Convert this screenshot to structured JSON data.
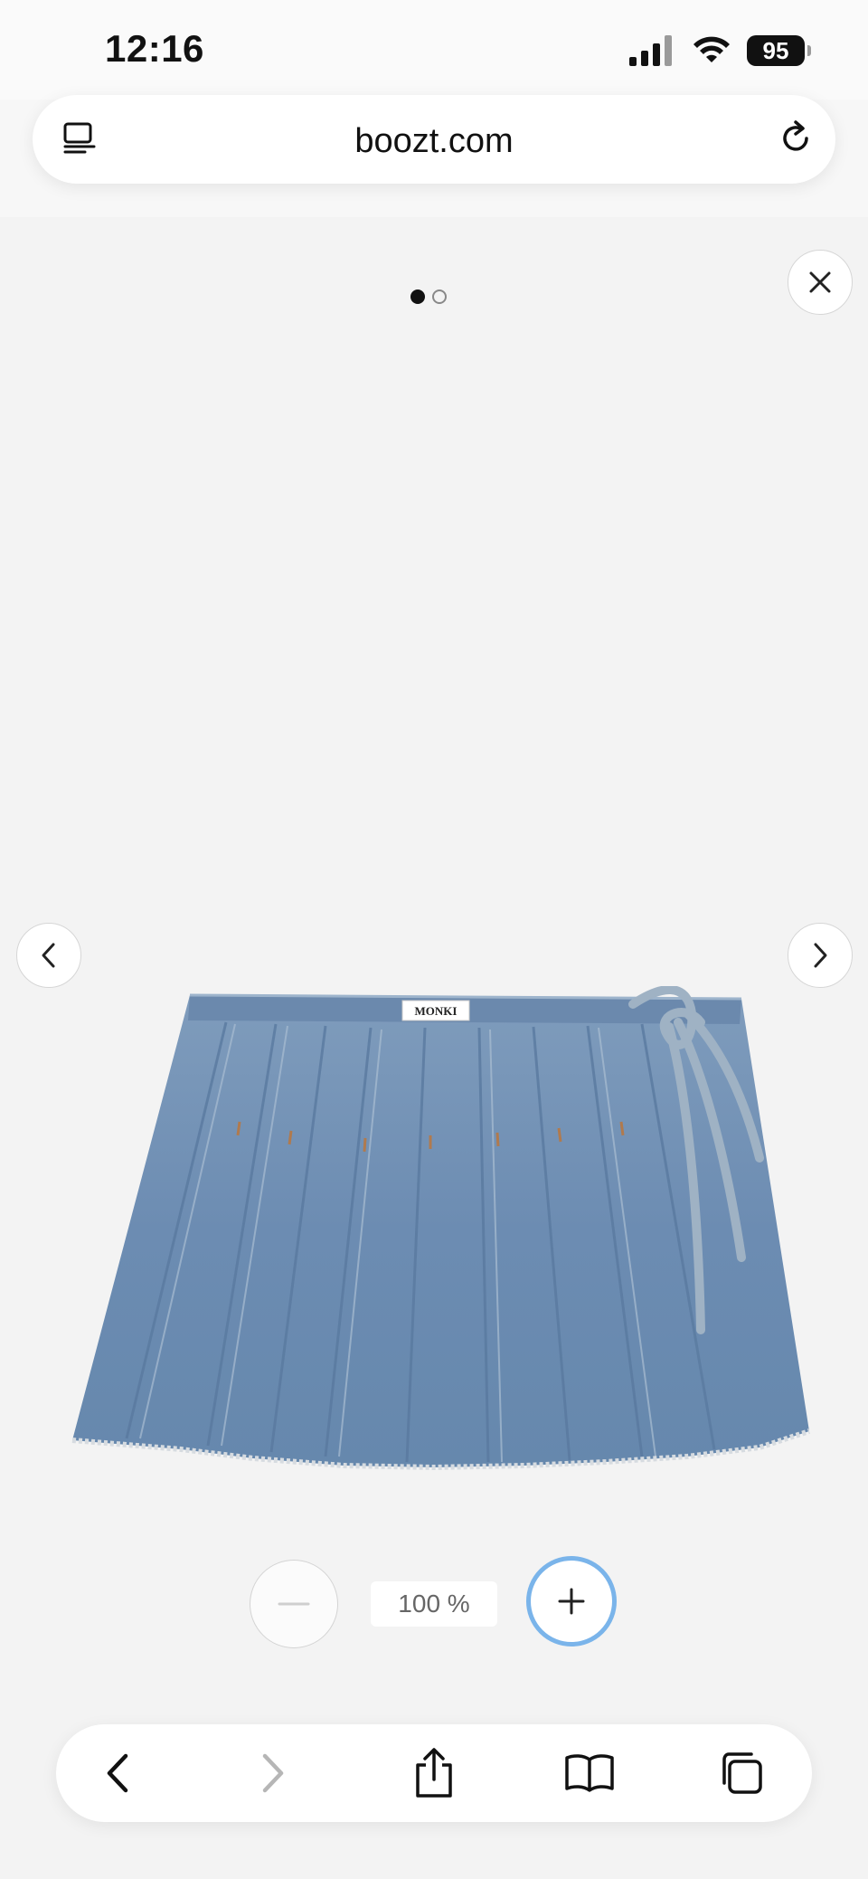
{
  "status_bar": {
    "time": "12:16",
    "battery": "95",
    "icons": [
      "signal-icon",
      "wifi-icon",
      "battery-icon"
    ]
  },
  "browser": {
    "url": "boozt.com",
    "left_icon": "page-menu-icon",
    "right_icon": "reload-icon"
  },
  "gallery": {
    "page_count": 2,
    "current_page": 1,
    "close_icon": "close-icon",
    "prev_icon": "chevron-left-icon",
    "next_icon": "chevron-right-icon",
    "product_label": "MONKI"
  },
  "zoom": {
    "level": "100 %",
    "zoom_out_icon": "minus-icon",
    "zoom_in_icon": "plus-icon"
  },
  "toolbar": {
    "icons": [
      "back-icon",
      "forward-icon",
      "share-icon",
      "bookmarks-icon",
      "tabs-icon"
    ]
  },
  "colors": {
    "background": "#f3f3f3",
    "focus_ring": "#7ab4ea",
    "denim": "#6d8eb3"
  }
}
